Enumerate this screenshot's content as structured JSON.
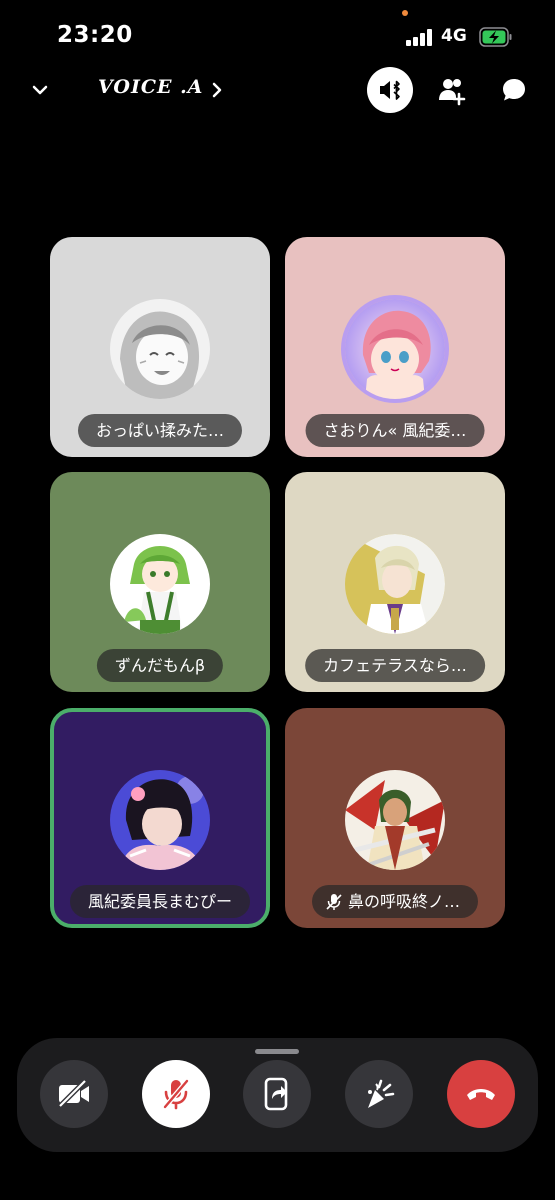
{
  "status": {
    "time": "23:20",
    "network": "4G"
  },
  "header": {
    "channel_title": "VOICE .A"
  },
  "participants": [
    {
      "name": "おっぱい揉みた…",
      "muted": false,
      "speaking": false
    },
    {
      "name": "さおりん« 風紀委…",
      "muted": false,
      "speaking": false
    },
    {
      "name": "ずんだもんβ",
      "muted": false,
      "speaking": false
    },
    {
      "name": "カフェテラスなら…",
      "muted": false,
      "speaking": false
    },
    {
      "name": "風紀委員長まむぴー",
      "muted": false,
      "speaking": true
    },
    {
      "name": "鼻の呼吸終ノ…",
      "muted": true,
      "speaking": false
    }
  ],
  "colors": {
    "tile_1": "#d9d9d9",
    "tile_2": "#e8c1c0",
    "tile_3": "#6d8a5a",
    "tile_4": "#ded8c3",
    "tile_5": "#321c62",
    "tile_6": "#7b4638",
    "speaking_ring": "#4bae6a",
    "hangup": "#d84040",
    "control_bar": "#1c1c1e"
  },
  "controls": [
    {
      "icon": "video-off-icon"
    },
    {
      "icon": "mic-off-icon"
    },
    {
      "icon": "screen-share-icon"
    },
    {
      "icon": "soundboard-icon"
    },
    {
      "icon": "hang-up-icon"
    }
  ]
}
